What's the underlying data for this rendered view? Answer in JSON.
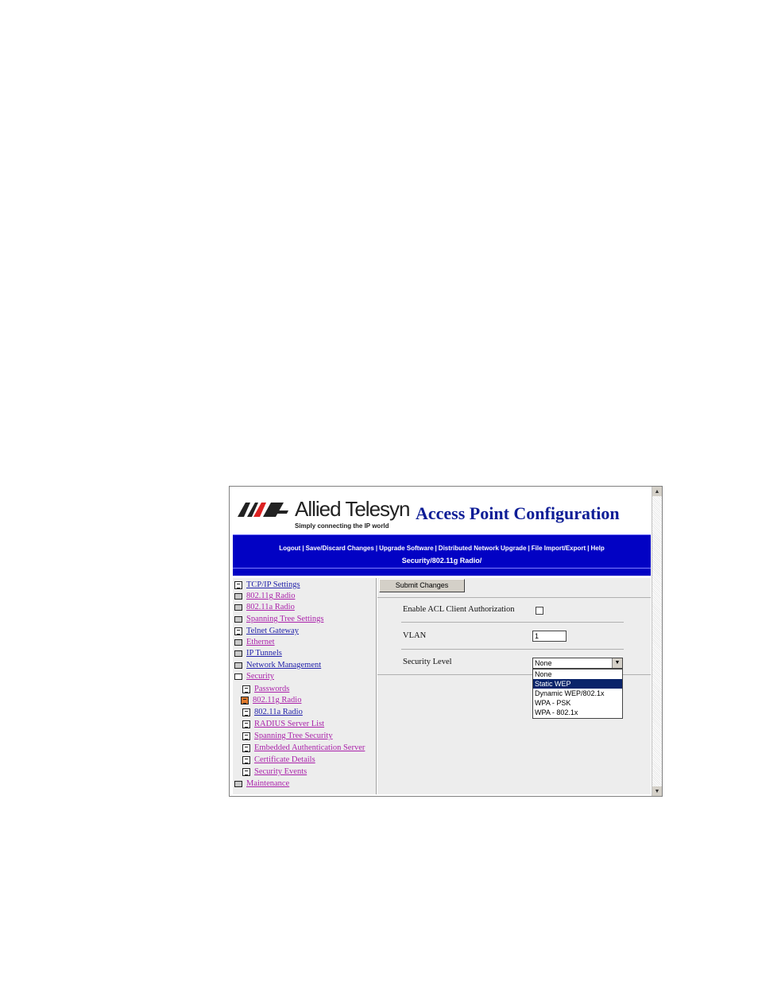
{
  "brand": {
    "name": "Allied Telesyn",
    "tagline": "Simply connecting the IP world"
  },
  "app_title": "Access Point Configuration",
  "nav": {
    "links": [
      "Logout",
      "Save/Discard Changes",
      "Upgrade Software",
      "Distributed Network Upgrade",
      "File Import/Export",
      "Help"
    ]
  },
  "breadcrumb": "Security/802.11g Radio/",
  "sidebar": {
    "items": [
      {
        "label": "TCP/IP Settings",
        "icon": "document-icon"
      },
      {
        "label": "802.11g Radio",
        "icon": "folder-icon"
      },
      {
        "label": "802.11a Radio",
        "icon": "folder-icon"
      },
      {
        "label": "Spanning Tree Settings",
        "icon": "folder-icon"
      },
      {
        "label": "Telnet Gateway",
        "icon": "document-icon"
      },
      {
        "label": "Ethernet",
        "icon": "folder-icon"
      },
      {
        "label": "IP Tunnels",
        "icon": "folder-icon"
      },
      {
        "label": "Network Management",
        "icon": "folder-icon"
      },
      {
        "label": "Security",
        "icon": "folder-open-icon"
      },
      {
        "label": "Passwords",
        "icon": "document-icon"
      },
      {
        "label": "802.11g Radio",
        "icon": "document-active-icon"
      },
      {
        "label": "802.11a Radio",
        "icon": "document-icon"
      },
      {
        "label": "RADIUS Server List",
        "icon": "document-icon"
      },
      {
        "label": "Spanning Tree Security",
        "icon": "document-icon"
      },
      {
        "label": "Embedded Authentication Server",
        "icon": "document-icon"
      },
      {
        "label": "Certificate Details",
        "icon": "document-icon"
      },
      {
        "label": "Security Events",
        "icon": "document-icon"
      },
      {
        "label": "Maintenance",
        "icon": "folder-icon"
      }
    ]
  },
  "form": {
    "submit_label": "Submit Changes",
    "acl_label": "Enable ACL Client Authorization",
    "acl_checked": false,
    "vlan_label": "VLAN",
    "vlan_value": "1",
    "security_label": "Security Level",
    "security_value": "None",
    "security_options": [
      "None",
      "Static WEP",
      "Dynamic WEP/802.1x",
      "WPA - PSK",
      "WPA - 802.1x"
    ],
    "highlighted_option": "Static WEP"
  },
  "colors": {
    "nav_bg": "#0202c4",
    "title": "#0d1d96",
    "link": "#2222aa",
    "visited_link": "#aa22aa",
    "selected_option_bg": "#0a246a",
    "active_doc_icon": "#e07a2c"
  }
}
